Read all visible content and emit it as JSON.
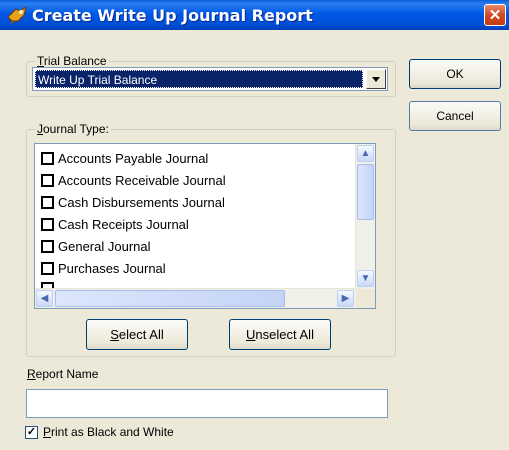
{
  "window": {
    "title": "Create Write Up Journal Report",
    "close_glyph": "✕"
  },
  "trial_balance": {
    "legend": {
      "mnemonic": "T",
      "rest": "rial Balance"
    },
    "selected_value": "Write Up Trial Balance"
  },
  "journal_type": {
    "legend": {
      "mnemonic": "J",
      "rest": "ournal Type:"
    },
    "items": [
      {
        "label": "Accounts Payable Journal",
        "checked": false
      },
      {
        "label": "Accounts Receivable Journal",
        "checked": false
      },
      {
        "label": "Cash Disbursements Journal",
        "checked": false
      },
      {
        "label": "Cash Receipts Journal",
        "checked": false
      },
      {
        "label": "General Journal",
        "checked": false
      },
      {
        "label": "Purchases Journal",
        "checked": false
      }
    ]
  },
  "buttons": {
    "ok": "OK",
    "cancel": "Cancel",
    "select_all": {
      "mnemonic": "S",
      "rest": "elect All"
    },
    "unselect_all": {
      "mnemonic": "U",
      "rest": "nselect All"
    }
  },
  "report_name": {
    "label": {
      "mnemonic": "R",
      "rest": "eport Name"
    },
    "value": ""
  },
  "print_bw": {
    "checked": true,
    "label": {
      "mnemonic": "P",
      "rest": "rint as Black and White"
    }
  }
}
